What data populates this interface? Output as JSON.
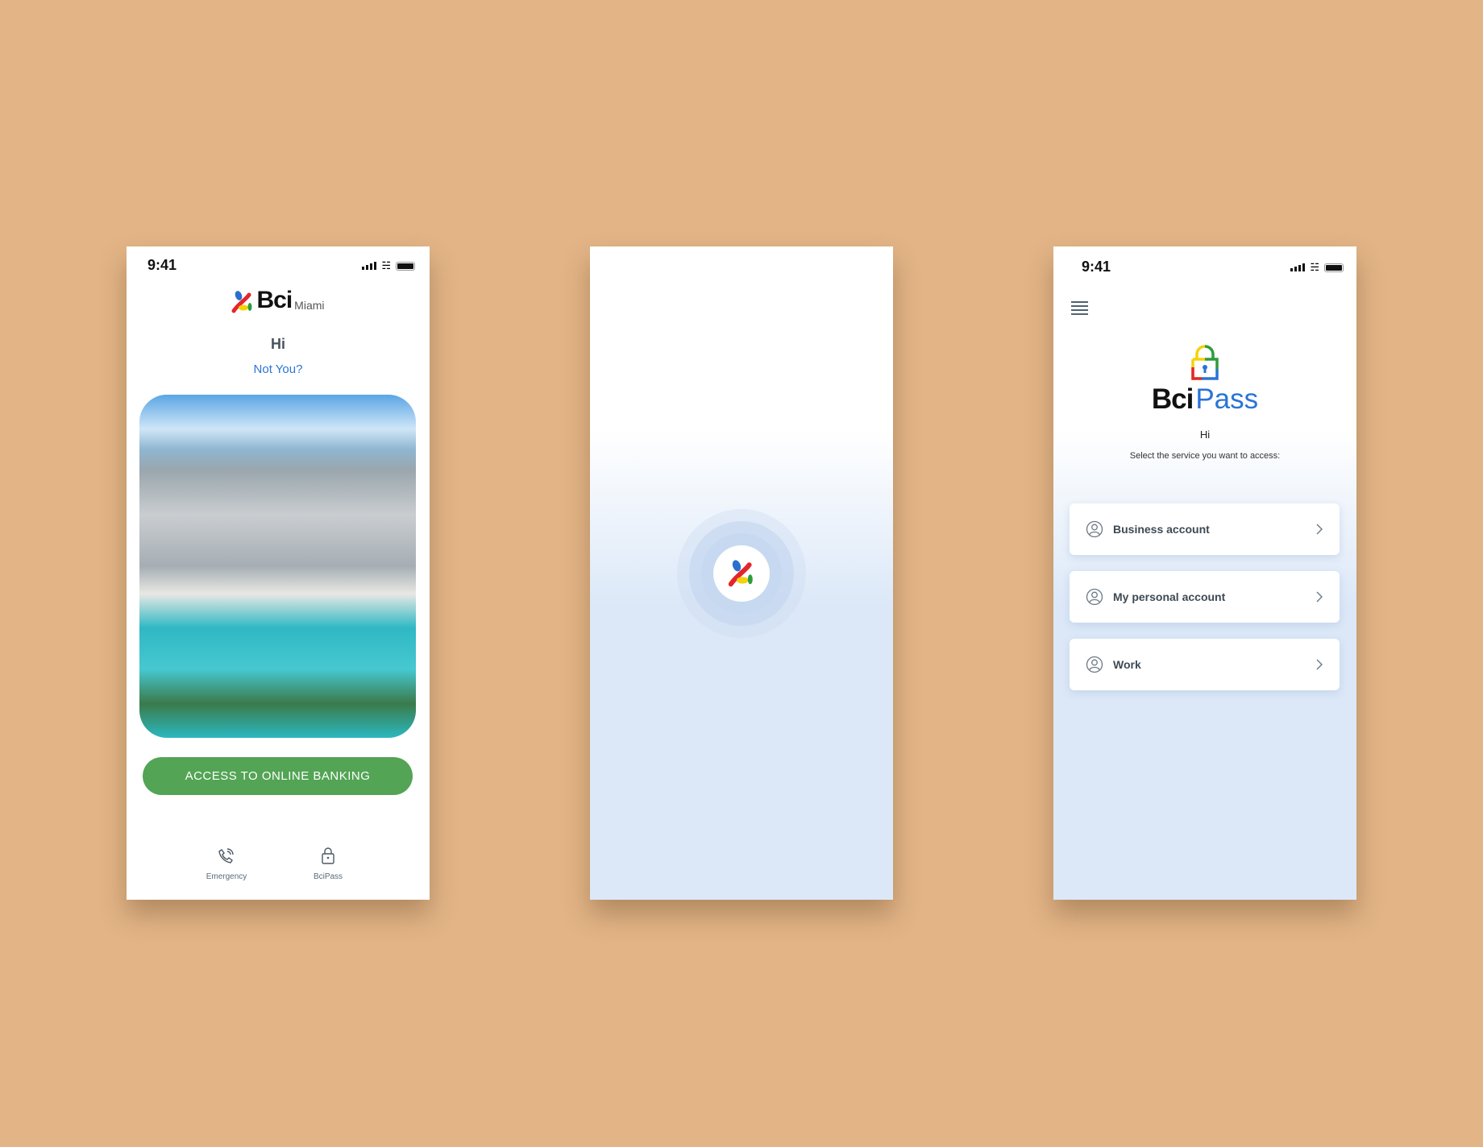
{
  "status_time": "9:41",
  "login": {
    "brand": "Bci",
    "brand_suffix": "Miami",
    "greeting": "Hi",
    "not_you": "Not You?",
    "access_button": "ACCESS TO ONLINE BANKING",
    "nav": [
      {
        "label": "Emergency",
        "icon": "phone-ringing-icon"
      },
      {
        "label": "BciPass",
        "icon": "lock-icon"
      }
    ]
  },
  "bcipass": {
    "brand_a": "Bci",
    "brand_b": "Pass",
    "greeting": "Hi",
    "prompt": "Select the service you want to access:",
    "services": [
      {
        "label": "Business account"
      },
      {
        "label": "My personal account"
      },
      {
        "label": "Work"
      }
    ]
  },
  "colors": {
    "green": "#53a455",
    "blue": "#2a74d6",
    "background": "#e2b486"
  }
}
